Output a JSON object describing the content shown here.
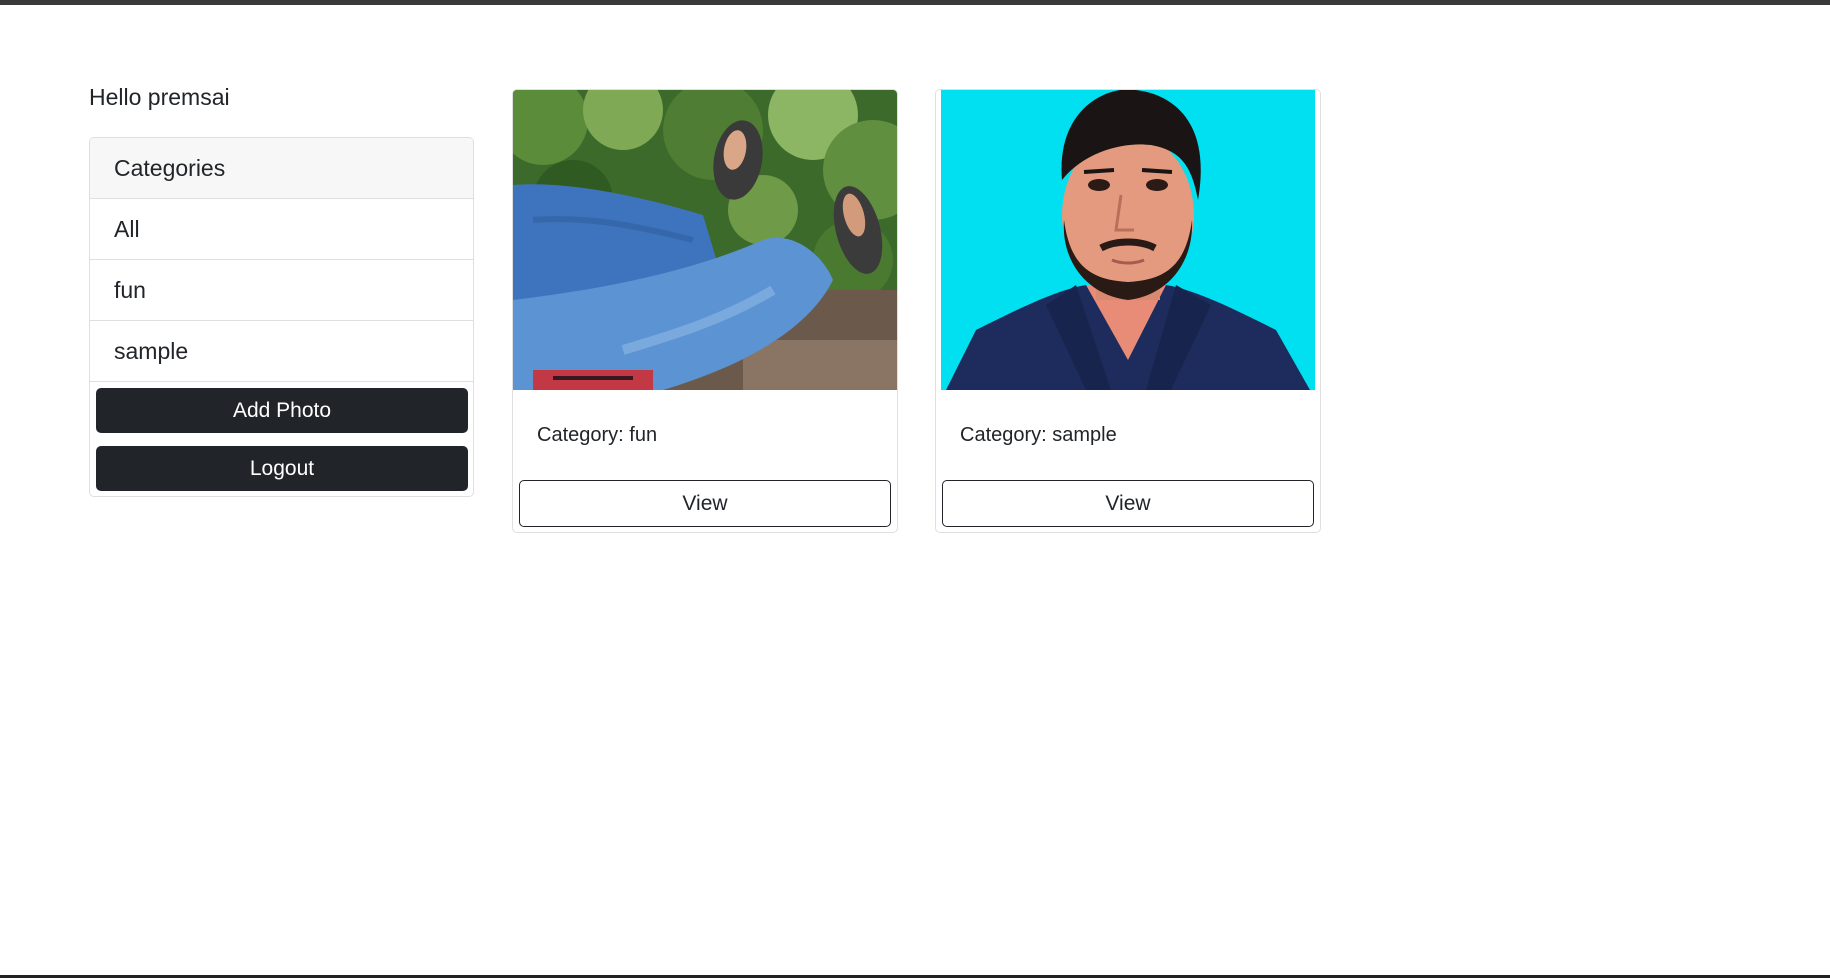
{
  "greeting": "Hello premsai",
  "categories": {
    "header": "Categories",
    "items": [
      {
        "label": "All"
      },
      {
        "label": "fun"
      },
      {
        "label": "sample"
      }
    ]
  },
  "buttons": {
    "add_photo": "Add Photo",
    "logout": "Logout"
  },
  "photos": [
    {
      "category_text": "Category: fun",
      "view_label": "View"
    },
    {
      "category_text": "Category: sample",
      "view_label": "View"
    }
  ],
  "colors": {
    "dark_button": "#212529",
    "panel_header_bg": "#f7f7f7",
    "border": "#dfdfdf",
    "portrait_background": "#00e0f0"
  }
}
